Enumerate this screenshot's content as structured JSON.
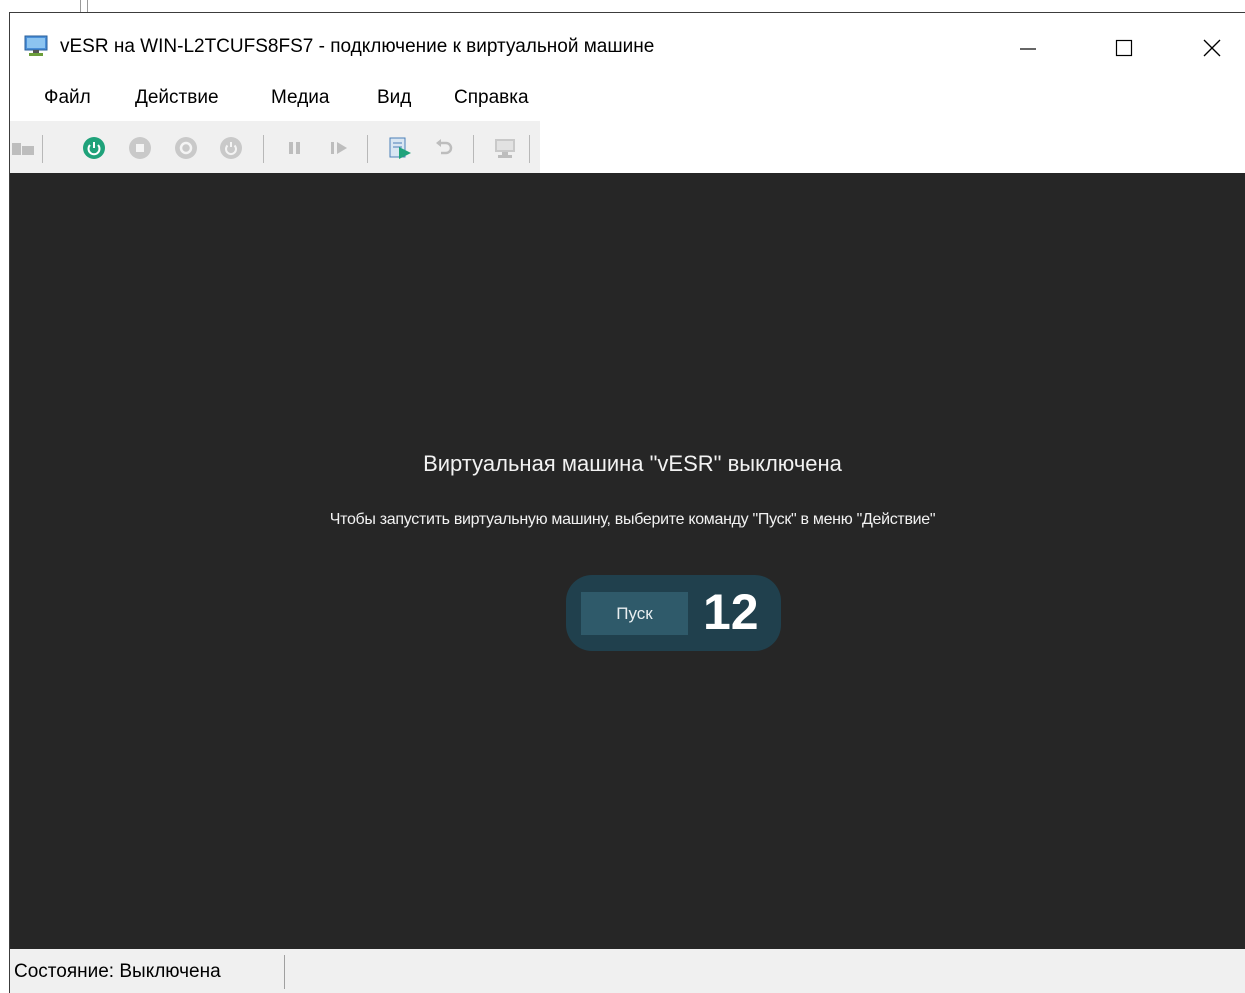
{
  "window": {
    "title": "vESR на WIN-L2TCUFS8FS7 - подключение к виртуальной машине",
    "controls": {
      "minimize": "—",
      "maximize": "☐",
      "close": "✕"
    }
  },
  "menu": {
    "items": [
      {
        "label": "Файл"
      },
      {
        "label": "Действие"
      },
      {
        "label": "Медиа"
      },
      {
        "label": "Вид"
      },
      {
        "label": "Справка"
      }
    ]
  },
  "toolbar": {
    "icons": [
      "ctrl-alt-del-icon",
      "start-icon",
      "turn-off-icon",
      "shutdown-icon",
      "save-icon",
      "pause-icon",
      "resume-icon",
      "checkpoint-icon",
      "revert-icon",
      "enhanced-session-icon"
    ]
  },
  "vm_screen": {
    "heading": "Виртуальная машина \"vESR\" выключена",
    "hint": "Чтобы запустить виртуальную машину, выберите команду \"Пуск\" в меню \"Действие\"",
    "start_button": "Пуск",
    "step_number": "12"
  },
  "status": {
    "text": "Состояние: Выключена"
  },
  "colors": {
    "screen_bg": "#262626",
    "start_pill": "#20404d",
    "start_button": "#2f5a6a",
    "start_icon_green": "#1fa27a"
  }
}
